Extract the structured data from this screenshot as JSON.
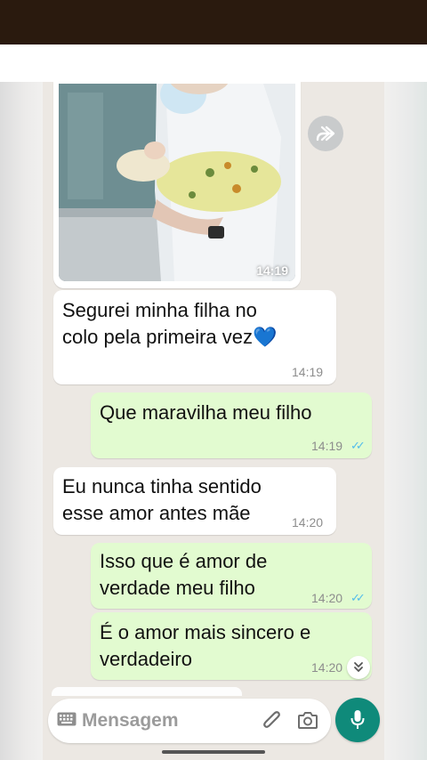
{
  "colors": {
    "incoming_bubble": "#ffffff",
    "outgoing_bubble": "#e2fbd0",
    "read_ticks": "#53bdeb",
    "mic_button": "#0f8a7a",
    "chat_background": "#ece8e3"
  },
  "image_message": {
    "time": "14:19",
    "forward_icon": "forward-icon"
  },
  "messages": [
    {
      "direction": "in",
      "line1": "Segurei minha filha no",
      "line2": "colo pela primeira vez💙",
      "time": "14:19"
    },
    {
      "direction": "out",
      "line1": "Que maravilha meu filho",
      "time": "14:19",
      "status": "read"
    },
    {
      "direction": "in",
      "line1": "Eu nunca tinha sentido",
      "line2": "esse amor antes mãe",
      "time": "14:20"
    },
    {
      "direction": "out",
      "line1": "Isso que é amor de",
      "line2": "verdade meu filho",
      "time": "14:20",
      "status": "read"
    },
    {
      "direction": "out",
      "line1": "É o amor mais sincero e",
      "line2": "verdadeiro",
      "time": "14:20"
    }
  ],
  "composer": {
    "placeholder": "Mensagem",
    "icons": [
      "keyboard-icon",
      "paperclip-icon",
      "camera-icon",
      "microphone-icon"
    ]
  },
  "scroll_down_icon": "double-chevron-down-icon"
}
